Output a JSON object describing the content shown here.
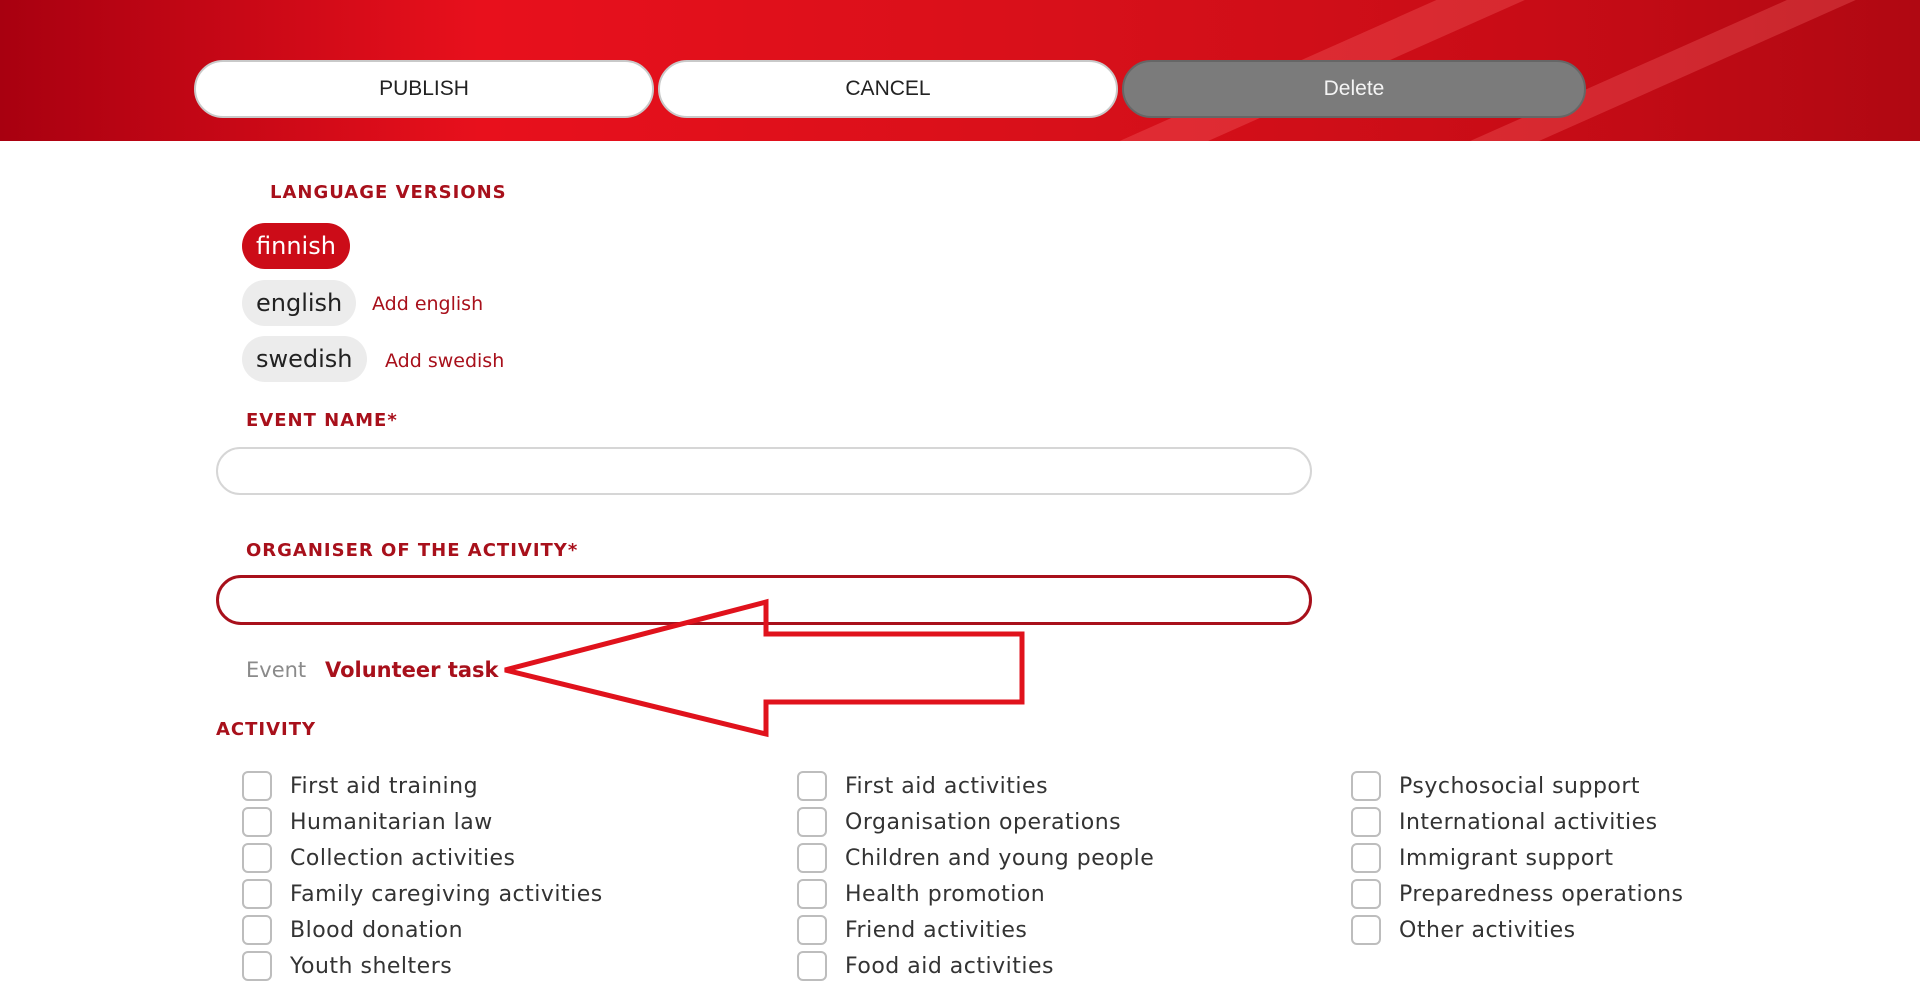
{
  "toolbar": {
    "publish_label": "PUBLISH",
    "cancel_label": "CANCEL",
    "delete_label": "Delete"
  },
  "language_versions": {
    "title": "LANGUAGE VERSIONS",
    "items": [
      {
        "label": "finnish",
        "active": true,
        "add_label": ""
      },
      {
        "label": "english",
        "active": false,
        "add_label": "Add english"
      },
      {
        "label": "swedish",
        "active": false,
        "add_label": "Add swedish"
      }
    ]
  },
  "event_name": {
    "label": "EVENT NAME*",
    "value": ""
  },
  "organiser": {
    "label": "ORGANISER OF THE ACTIVITY*",
    "value": ""
  },
  "type_tabs": {
    "event": "Event",
    "volunteer": "Volunteer task"
  },
  "activity": {
    "title": "ACTIVITY",
    "columns": [
      [
        "First aid training",
        "Humanitarian law",
        "Collection activities",
        "Family caregiving activities",
        "Blood donation",
        "Youth shelters"
      ],
      [
        "First aid activities",
        "Organisation operations",
        "Children and young people",
        "Health promotion",
        "Friend activities",
        "Food aid activities"
      ],
      [
        "Psychosocial support",
        "International activities",
        "Immigrant support",
        "Preparedness operations",
        "Other activities"
      ]
    ]
  },
  "colors": {
    "brand_red": "#cc0c18",
    "label_red": "#a8101b",
    "annotation_arrow": "#e0121c"
  }
}
